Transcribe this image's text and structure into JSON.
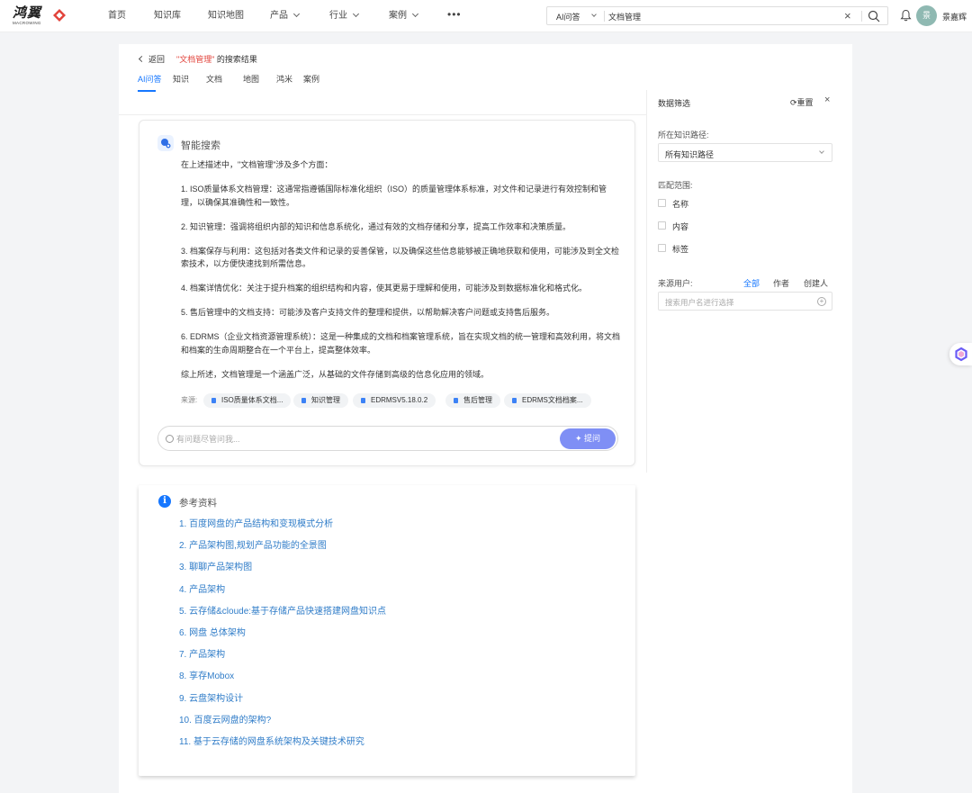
{
  "brand": {
    "name": "鸿翼",
    "sub": "MACROWING",
    "accent": "#e2433b"
  },
  "nav": {
    "items": [
      "首页",
      "知识库",
      "知识地图",
      "产品",
      "行业",
      "案例"
    ],
    "more": "•••"
  },
  "search": {
    "type": "AI问答",
    "value": "文档管理",
    "clear": "×"
  },
  "user": {
    "avatar_text": "景",
    "name": "景嘉辉"
  },
  "header": {
    "back": "返回",
    "query_quoted": "\"文档管理\"",
    "result_suffix": " 的搜索结果"
  },
  "tabs": [
    "AI问答",
    "知识",
    "文档",
    "地图",
    "鸿米",
    "案例"
  ],
  "filter": {
    "title": "数据筛选",
    "reset": "重置",
    "close": "×",
    "path_label": "所在知识路径:",
    "path_value": "所有知识路径",
    "match_label": "匹配范围:",
    "match_options": [
      "名称",
      "内容",
      "标签"
    ],
    "source_label": "来源用户:",
    "source_options": [
      "全部",
      "作者",
      "创建人"
    ],
    "user_placeholder": "搜索用户名进行选择"
  },
  "ai": {
    "title": "智能搜索",
    "paragraphs": [
      "在上述描述中，\"文档管理\"涉及多个方面：",
      "1. ISO质量体系文档管理：这通常指遵循国际标准化组织（ISO）的质量管理体系标准，对文件和记录进行有效控制和管理，以确保其准确性和一致性。",
      "2. 知识管理：强调将组织内部的知识和信息系统化，通过有效的文档存储和分享，提高工作效率和决策质量。",
      "3. 档案保存与利用：这包括对各类文件和记录的妥善保管，以及确保这些信息能够被正确地获取和使用，可能涉及到全文检索技术，以方便快速找到所需信息。",
      "4. 档案详情优化：关注于提升档案的组织结构和内容，使其更易于理解和使用，可能涉及到数据标准化和格式化。",
      "5. 售后管理中的文档支持：可能涉及客户支持文件的整理和提供，以帮助解决客户问题或支持售后服务。",
      "6. EDRMS（企业文档资源管理系统）：这是一种集成的文档和档案管理系统，旨在实现文档的统一管理和高效利用，将文档和档案的生命周期整合在一个平台上，提高整体效率。",
      "综上所述，文档管理是一个涵盖广泛，从基础的文件存储到高级的信息化应用的领域。"
    ],
    "source_label": "来源:",
    "sources": [
      "ISO质量体系文档...",
      "知识管理",
      "EDRMSV5.18.0.2",
      "售后管理",
      "EDRMS文档档案..."
    ],
    "ask_placeholder": "有问题尽管问我...",
    "ask_button": "提问"
  },
  "refs": {
    "title": "参考资料",
    "items": [
      "1. 百度网盘的产品结构和变现模式分析",
      "2. 产品架构图,规划产品功能的全景图",
      "3. 聊聊产品架构图",
      "4. 产品架构",
      "5. 云存储&cloude:基于存储产品快速搭建网盘知识点",
      "6. 网盘 总体架构",
      "7. 产品架构",
      "8. 享存Mobox",
      "9. 云盘架构设计",
      "10. 百度云网盘的架构?",
      "11. 基于云存储的网盘系统架构及关键技术研究"
    ]
  }
}
